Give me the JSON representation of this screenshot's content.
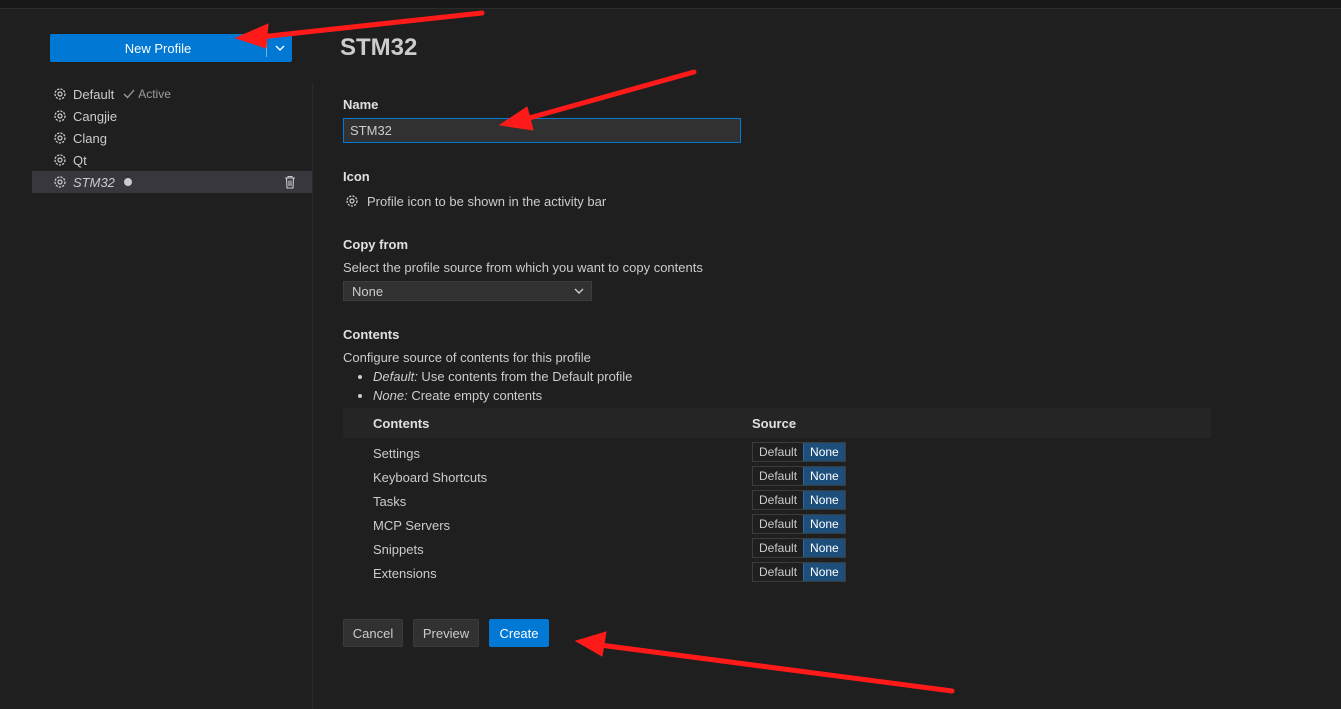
{
  "sidebar": {
    "new_profile_label": "New Profile",
    "profiles": [
      {
        "name": "Default",
        "active_label": "Active"
      },
      {
        "name": "Cangjie"
      },
      {
        "name": "Clang"
      },
      {
        "name": "Qt"
      },
      {
        "name": "STM32",
        "selected": true,
        "unsaved": true
      }
    ]
  },
  "main": {
    "title": "STM32",
    "name_label": "Name",
    "name_value": "STM32",
    "icon_label": "Icon",
    "icon_desc": "Profile icon to be shown in the activity bar",
    "copy_label": "Copy from",
    "copy_desc": "Select the profile source from which you want to copy contents",
    "copy_value": "None",
    "contents_label": "Contents",
    "contents_desc": "Configure source of contents for this profile",
    "bullets": [
      {
        "term": "Default:",
        "text": " Use contents from the Default profile"
      },
      {
        "term": "None:",
        "text": " Create empty contents"
      }
    ],
    "table": {
      "col_contents": "Contents",
      "col_source": "Source",
      "option_default": "Default",
      "option_none": "None",
      "rows": [
        "Settings",
        "Keyboard Shortcuts",
        "Tasks",
        "MCP Servers",
        "Snippets",
        "Extensions"
      ]
    },
    "buttons": {
      "cancel": "Cancel",
      "preview": "Preview",
      "create": "Create"
    }
  },
  "annotations": {
    "arrow_color": "#ff1a1a"
  },
  "icons": {
    "profile": "gear-icon",
    "selected_check": "check-icon",
    "delete": "trash-icon",
    "dropdown": "chevron-down-icon"
  }
}
